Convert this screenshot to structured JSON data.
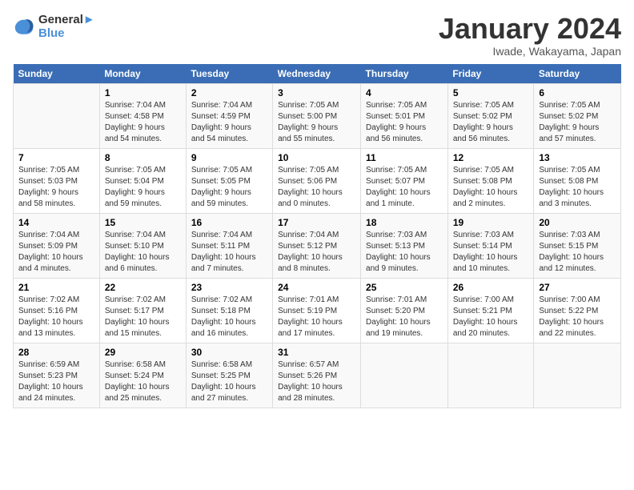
{
  "header": {
    "logo_line1": "General",
    "logo_line2": "Blue",
    "month": "January 2024",
    "location": "Iwade, Wakayama, Japan"
  },
  "weekdays": [
    "Sunday",
    "Monday",
    "Tuesday",
    "Wednesday",
    "Thursday",
    "Friday",
    "Saturday"
  ],
  "weeks": [
    [
      {
        "day": "",
        "info": ""
      },
      {
        "day": "1",
        "info": "Sunrise: 7:04 AM\nSunset: 4:58 PM\nDaylight: 9 hours\nand 54 minutes."
      },
      {
        "day": "2",
        "info": "Sunrise: 7:04 AM\nSunset: 4:59 PM\nDaylight: 9 hours\nand 54 minutes."
      },
      {
        "day": "3",
        "info": "Sunrise: 7:05 AM\nSunset: 5:00 PM\nDaylight: 9 hours\nand 55 minutes."
      },
      {
        "day": "4",
        "info": "Sunrise: 7:05 AM\nSunset: 5:01 PM\nDaylight: 9 hours\nand 56 minutes."
      },
      {
        "day": "5",
        "info": "Sunrise: 7:05 AM\nSunset: 5:02 PM\nDaylight: 9 hours\nand 56 minutes."
      },
      {
        "day": "6",
        "info": "Sunrise: 7:05 AM\nSunset: 5:02 PM\nDaylight: 9 hours\nand 57 minutes."
      }
    ],
    [
      {
        "day": "7",
        "info": "Sunrise: 7:05 AM\nSunset: 5:03 PM\nDaylight: 9 hours\nand 58 minutes."
      },
      {
        "day": "8",
        "info": "Sunrise: 7:05 AM\nSunset: 5:04 PM\nDaylight: 9 hours\nand 59 minutes."
      },
      {
        "day": "9",
        "info": "Sunrise: 7:05 AM\nSunset: 5:05 PM\nDaylight: 9 hours\nand 59 minutes."
      },
      {
        "day": "10",
        "info": "Sunrise: 7:05 AM\nSunset: 5:06 PM\nDaylight: 10 hours\nand 0 minutes."
      },
      {
        "day": "11",
        "info": "Sunrise: 7:05 AM\nSunset: 5:07 PM\nDaylight: 10 hours\nand 1 minute."
      },
      {
        "day": "12",
        "info": "Sunrise: 7:05 AM\nSunset: 5:08 PM\nDaylight: 10 hours\nand 2 minutes."
      },
      {
        "day": "13",
        "info": "Sunrise: 7:05 AM\nSunset: 5:08 PM\nDaylight: 10 hours\nand 3 minutes."
      }
    ],
    [
      {
        "day": "14",
        "info": "Sunrise: 7:04 AM\nSunset: 5:09 PM\nDaylight: 10 hours\nand 4 minutes."
      },
      {
        "day": "15",
        "info": "Sunrise: 7:04 AM\nSunset: 5:10 PM\nDaylight: 10 hours\nand 6 minutes."
      },
      {
        "day": "16",
        "info": "Sunrise: 7:04 AM\nSunset: 5:11 PM\nDaylight: 10 hours\nand 7 minutes."
      },
      {
        "day": "17",
        "info": "Sunrise: 7:04 AM\nSunset: 5:12 PM\nDaylight: 10 hours\nand 8 minutes."
      },
      {
        "day": "18",
        "info": "Sunrise: 7:03 AM\nSunset: 5:13 PM\nDaylight: 10 hours\nand 9 minutes."
      },
      {
        "day": "19",
        "info": "Sunrise: 7:03 AM\nSunset: 5:14 PM\nDaylight: 10 hours\nand 10 minutes."
      },
      {
        "day": "20",
        "info": "Sunrise: 7:03 AM\nSunset: 5:15 PM\nDaylight: 10 hours\nand 12 minutes."
      }
    ],
    [
      {
        "day": "21",
        "info": "Sunrise: 7:02 AM\nSunset: 5:16 PM\nDaylight: 10 hours\nand 13 minutes."
      },
      {
        "day": "22",
        "info": "Sunrise: 7:02 AM\nSunset: 5:17 PM\nDaylight: 10 hours\nand 15 minutes."
      },
      {
        "day": "23",
        "info": "Sunrise: 7:02 AM\nSunset: 5:18 PM\nDaylight: 10 hours\nand 16 minutes."
      },
      {
        "day": "24",
        "info": "Sunrise: 7:01 AM\nSunset: 5:19 PM\nDaylight: 10 hours\nand 17 minutes."
      },
      {
        "day": "25",
        "info": "Sunrise: 7:01 AM\nSunset: 5:20 PM\nDaylight: 10 hours\nand 19 minutes."
      },
      {
        "day": "26",
        "info": "Sunrise: 7:00 AM\nSunset: 5:21 PM\nDaylight: 10 hours\nand 20 minutes."
      },
      {
        "day": "27",
        "info": "Sunrise: 7:00 AM\nSunset: 5:22 PM\nDaylight: 10 hours\nand 22 minutes."
      }
    ],
    [
      {
        "day": "28",
        "info": "Sunrise: 6:59 AM\nSunset: 5:23 PM\nDaylight: 10 hours\nand 24 minutes."
      },
      {
        "day": "29",
        "info": "Sunrise: 6:58 AM\nSunset: 5:24 PM\nDaylight: 10 hours\nand 25 minutes."
      },
      {
        "day": "30",
        "info": "Sunrise: 6:58 AM\nSunset: 5:25 PM\nDaylight: 10 hours\nand 27 minutes."
      },
      {
        "day": "31",
        "info": "Sunrise: 6:57 AM\nSunset: 5:26 PM\nDaylight: 10 hours\nand 28 minutes."
      },
      {
        "day": "",
        "info": ""
      },
      {
        "day": "",
        "info": ""
      },
      {
        "day": "",
        "info": ""
      }
    ]
  ]
}
